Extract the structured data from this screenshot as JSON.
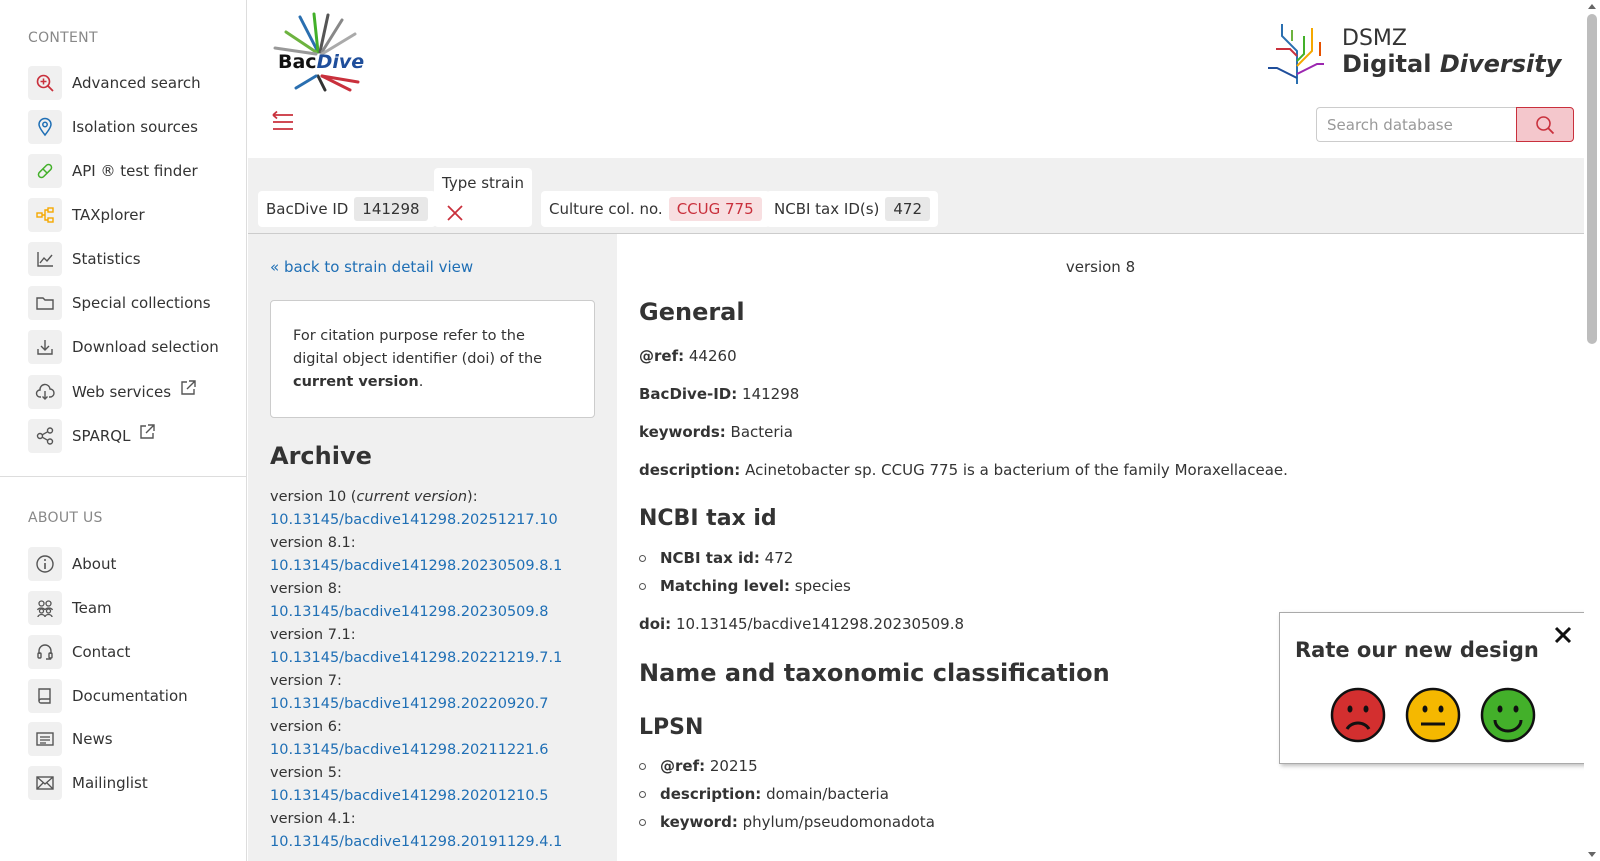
{
  "sidebar": {
    "content_heading": "CONTENT",
    "about_heading": "ABOUT US",
    "content_items": [
      {
        "label": "Advanced search",
        "icon": "search-plus-icon"
      },
      {
        "label": "Isolation sources",
        "icon": "map-pin-icon"
      },
      {
        "label": "API ® test finder",
        "icon": "pill-icon"
      },
      {
        "label": "TAXplorer",
        "icon": "tree-icon"
      },
      {
        "label": "Statistics",
        "icon": "chart-line-icon"
      },
      {
        "label": "Special collections",
        "icon": "folder-icon"
      },
      {
        "label": "Download selection",
        "icon": "download-icon"
      },
      {
        "label": "Web services",
        "icon": "cloud-download-icon"
      },
      {
        "label": "SPARQL",
        "icon": "share-nodes-icon"
      }
    ],
    "about_items": [
      {
        "label": "About",
        "icon": "info-icon"
      },
      {
        "label": "Team",
        "icon": "team-icon"
      },
      {
        "label": "Contact",
        "icon": "headset-icon"
      },
      {
        "label": "Documentation",
        "icon": "book-icon"
      },
      {
        "label": "News",
        "icon": "newspaper-icon"
      },
      {
        "label": "Mailinglist",
        "icon": "envelope-icon"
      }
    ]
  },
  "header": {
    "logo_text": "BacDive",
    "partner_line1": "DSMZ",
    "partner_line2a": "Digital ",
    "partner_line2b": "Diversity",
    "search_placeholder": "Search database",
    "search_value": ""
  },
  "infobar": {
    "bacdive_id_label": "BacDive ID",
    "bacdive_id_value": "141298",
    "type_strain_label": "Type strain",
    "culture_label": "Culture col. no.",
    "culture_value": "CCUG 775",
    "ncbi_label": "NCBI tax ID(s)",
    "ncbi_value": "472"
  },
  "left": {
    "back_link": "« back to strain detail view",
    "citation_text1": "For citation purpose refer to the digital object identifier (doi) of the ",
    "citation_bold": "current version",
    "citation_end": ".",
    "archive_title": "Archive",
    "archive": [
      {
        "label": "version 10 (",
        "italic": "current version",
        "label_end": "):",
        "doi": "10.13145/bacdive141298.20251217.10"
      },
      {
        "label": "version 8.1:",
        "italic": "",
        "label_end": "",
        "doi": "10.13145/bacdive141298.20230509.8.1"
      },
      {
        "label": "version 8:",
        "italic": "",
        "label_end": "",
        "doi": "10.13145/bacdive141298.20230509.8"
      },
      {
        "label": "version 7.1:",
        "italic": "",
        "label_end": "",
        "doi": "10.13145/bacdive141298.20221219.7.1"
      },
      {
        "label": "version 7:",
        "italic": "",
        "label_end": "",
        "doi": "10.13145/bacdive141298.20220920.7"
      },
      {
        "label": "version 6:",
        "italic": "",
        "label_end": "",
        "doi": "10.13145/bacdive141298.20211221.6"
      },
      {
        "label": "version 5:",
        "italic": "",
        "label_end": "",
        "doi": "10.13145/bacdive141298.20201210.5"
      },
      {
        "label": "version 4.1:",
        "italic": "",
        "label_end": "",
        "doi": "10.13145/bacdive141298.20191129.4.1"
      }
    ]
  },
  "main": {
    "version_label": "version 8",
    "general_title": "General",
    "ref_label": "@ref:",
    "ref_value": "44260",
    "bacdive_label": "BacDive-ID:",
    "bacdive_value": "141298",
    "keywords_label": "keywords:",
    "keywords_value": "Bacteria",
    "description_label": "description:",
    "description_value": "Acinetobacter sp. CCUG 775 is a bacterium of the family Moraxellaceae.",
    "ncbi_title": "NCBI tax id",
    "ncbi_taxid_label": "NCBI tax id:",
    "ncbi_taxid_value": "472",
    "matching_label": "Matching level:",
    "matching_value": "species",
    "doi_label": "doi:",
    "doi_value": "10.13145/bacdive141298.20230509.8",
    "name_title": "Name and taxonomic classification",
    "lpsn_title": "LPSN",
    "lpsn_ref_label": "@ref:",
    "lpsn_ref_value": "20215",
    "lpsn_desc_label": "description:",
    "lpsn_desc_value": "domain/bacteria",
    "lpsn_kw_label": "keyword:",
    "lpsn_kw_value": "phylum/pseudomonadota"
  },
  "rating": {
    "title": "Rate our new design",
    "options": [
      "sad-face-icon",
      "neutral-face-icon",
      "happy-face-icon"
    ]
  },
  "colors": {
    "accent": "#c9303c",
    "link": "#1f6fb5",
    "sad": "#d32f2f",
    "neutral": "#f5b800",
    "happy": "#43b02a"
  }
}
